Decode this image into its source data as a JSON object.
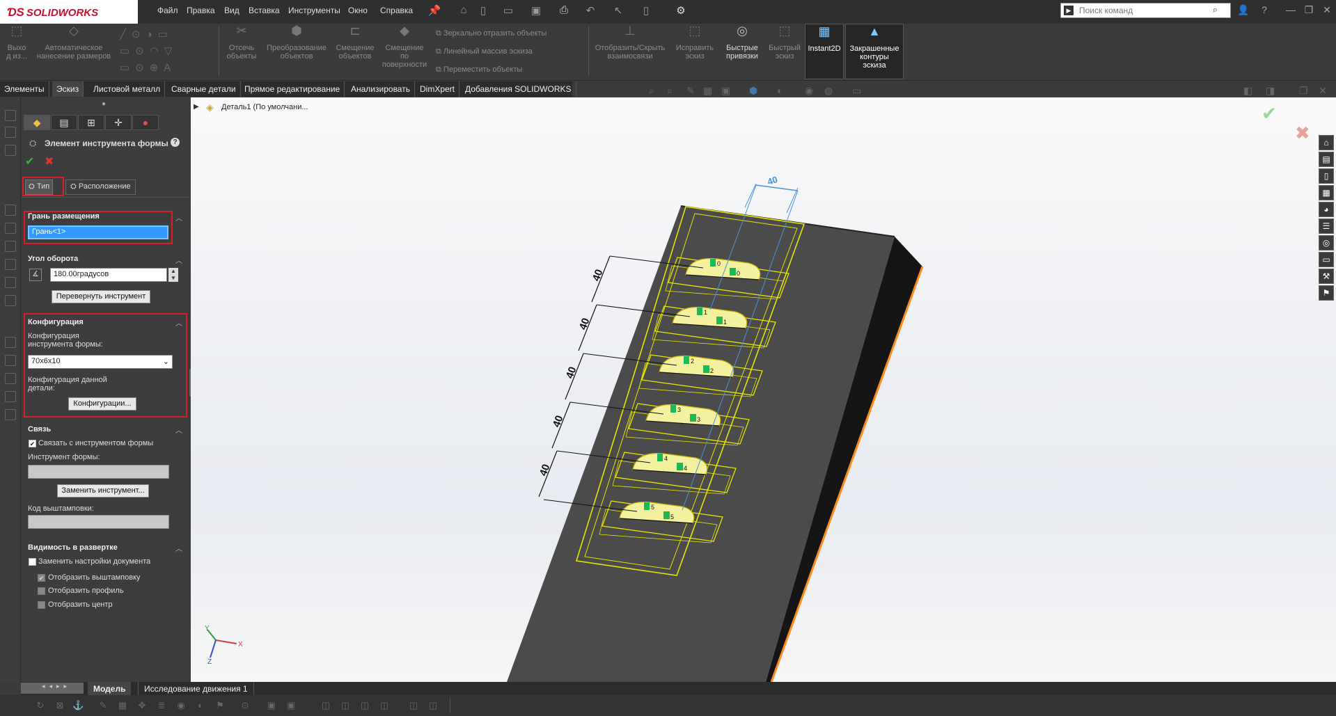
{
  "app": {
    "name": "SOLIDWORKS"
  },
  "menu": [
    "Файл",
    "Правка",
    "Вид",
    "Вставка",
    "Инструменты",
    "Окно",
    "Справка"
  ],
  "search": {
    "placeholder": "Поиск команд"
  },
  "ribbon": {
    "exit_sketch": "Выхо\nд из...",
    "smart_dim": "Автоматическое\nнанесение размеров",
    "trim": "Отсечь\nобъекты",
    "convert": "Преобразование\nобъектов",
    "offset": "Смещение\nобъектов",
    "offset_surface": "Смещение\nпо\nповерхности",
    "mirror": "Зеркально отразить объекты",
    "linear_pattern": "Линейный массив эскиза",
    "move": "Переместить объекты",
    "show_hide": "Отобразить/Скрыть\nвзаимосвязи",
    "repair": "Исправить\nэскиз",
    "quick_snaps": "Быстрые\nпривязки",
    "rapid_sketch": "Быстрый\nэскиз",
    "instant2d": "Instant2D",
    "shaded": "Закрашенные\nконтуры\nэскиза"
  },
  "tabs": [
    "Элементы",
    "Эскиз",
    "Листовой металл",
    "Сварные детали",
    "Прямое редактирование",
    "Анализировать",
    "DimXpert",
    "Добавления SOLIDWORKS"
  ],
  "tree": {
    "root": "Деталь1  (По умолчани..."
  },
  "panel": {
    "title": "Элемент инструмента формы",
    "tab_type": "Тип",
    "tab_position": "Расположение",
    "placement_face": {
      "header": "Грань размещения",
      "value": "Грань<1>"
    },
    "rotation": {
      "header": "Угол оборота",
      "value": "180.00градусов",
      "flip_button": "Перевернуть инструмент"
    },
    "config": {
      "header": "Конфигурация",
      "tool_label": "Конфигурация\nинструмента формы:",
      "tool_value": "70x6x10",
      "part_label": "Конфигурация данной\nдетали:",
      "button": "Конфигурации..."
    },
    "link": {
      "header": "Связь",
      "link_checkbox": "Связать с инструментом формы",
      "tool_label": "Инструмент формы:",
      "replace_button": "Заменить инструмент...",
      "punch_label": "Код выштамповки:"
    },
    "visibility": {
      "header": "Видимость в развертке",
      "override": "Заменить настройки документа",
      "show_punch": "Отобразить выштамповку",
      "show_profile": "Отобразить профиль",
      "show_center": "Отобразить центр"
    }
  },
  "viewport": {
    "dims": [
      "40",
      "40",
      "40",
      "40",
      "40"
    ],
    "top_dim": "40",
    "marks": [
      "0",
      "0",
      "1",
      "1",
      "2",
      "2",
      "3",
      "3",
      "4",
      "4",
      "5",
      "5"
    ],
    "triad": {
      "x": "X",
      "y": "Y",
      "z": "Z"
    }
  },
  "bottom_tabs": [
    "Модель",
    "Исследование движения 1"
  ],
  "colors": {
    "accent_red": "#d91e2a",
    "highlight_blue": "#1e90ff",
    "tool_yellow": "#e6e600",
    "body_dark": "#4a4a4a"
  }
}
